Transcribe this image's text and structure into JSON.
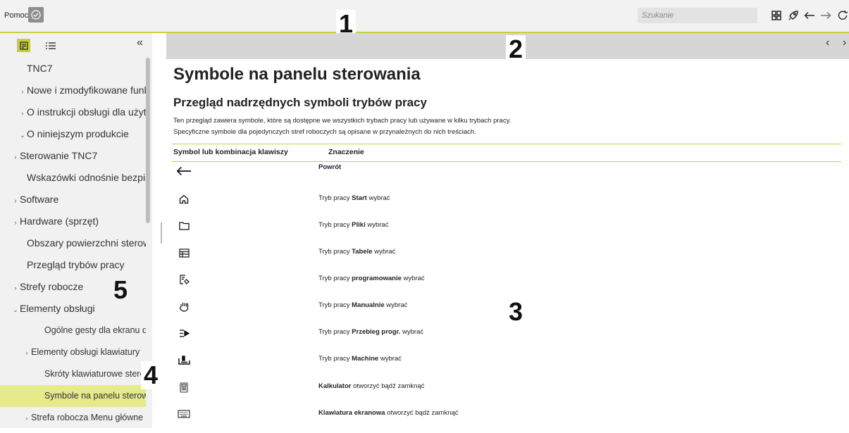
{
  "app": {
    "title": "Pomoc"
  },
  "search": {
    "placeholder": "Szukanie"
  },
  "markers": [
    "1",
    "2",
    "3",
    "4",
    "5"
  ],
  "sidebar": {
    "items": [
      {
        "label": "TNC7",
        "arrow": "",
        "level": 0
      },
      {
        "label": "Nowe i zmodyfikowane funkcje",
        "arrow": "›",
        "level": 0
      },
      {
        "label": "O instrukcji obsługi dla użytkownika",
        "arrow": "›",
        "level": 0
      },
      {
        "label": "O niniejszym produkcie",
        "arrow": "⌄",
        "level": 0
      },
      {
        "label": "Sterowanie TNC7",
        "arrow": "›",
        "level": 1
      },
      {
        "label": "Wskazówki odnośnie bezpieczeństwa",
        "arrow": "",
        "level": 1
      },
      {
        "label": "Software",
        "arrow": "›",
        "level": 1
      },
      {
        "label": "Hardware (sprzęt)",
        "arrow": "›",
        "level": 1
      },
      {
        "label": "Obszary powierzchni sterowania",
        "arrow": "",
        "level": 1
      },
      {
        "label": "Przegląd trybów pracy",
        "arrow": "",
        "level": 1
      },
      {
        "label": "Strefy robocze",
        "arrow": "›",
        "level": 1
      },
      {
        "label": "Elementy obsługi",
        "arrow": "⌄",
        "level": 1
      },
      {
        "label": "Ogólne gesty dla ekranu dotykowego",
        "arrow": "",
        "level": 2
      },
      {
        "label": "Elementy obsługi klawiatury",
        "arrow": "›",
        "level": 2
      },
      {
        "label": "Skróty klawiaturowe sterowania",
        "arrow": "",
        "level": 2
      },
      {
        "label": "Symbole na panelu sterowania",
        "arrow": "",
        "level": 2,
        "active": true
      },
      {
        "label": "Strefa robocza Menu główne",
        "arrow": "›",
        "level": 2
      }
    ]
  },
  "content": {
    "title": "Symbole na panelu sterowania",
    "section_title": "Przegląd nadrzędnych symboli trybów pracy",
    "intro_line1": "Ten przegląd zawiera symbole, które są dostępne we wszystkich trybach pracy lub używane w kilku trybach pracy.",
    "intro_line2": "Specyficzne symbole dla pojedynczych stref roboczych są opisane w przynależnych do nich treściach.",
    "table": {
      "col1": "Symbol lub kombinacja klawiszy",
      "col2": "Znaczenie",
      "rows": [
        {
          "icon": "back-arrow-icon",
          "pre": "",
          "bold": "Powrót",
          "post": ""
        },
        {
          "icon": "home-icon",
          "pre": "Tryb pracy ",
          "bold": "Start",
          "post": " wybrać"
        },
        {
          "icon": "folder-icon",
          "pre": "Tryb pracy ",
          "bold": "Pliki",
          "post": " wybrać"
        },
        {
          "icon": "table-icon",
          "pre": "Tryb pracy ",
          "bold": "Tabele",
          "post": " wybrać"
        },
        {
          "icon": "program-edit-icon",
          "pre": "Tryb pracy ",
          "bold": "programowanie",
          "post": " wybrać"
        },
        {
          "icon": "hand-icon",
          "pre": "Tryb pracy ",
          "bold": "Manualnie",
          "post": " wybrać"
        },
        {
          "icon": "program-run-icon",
          "pre": "Tryb pracy ",
          "bold": "Przebieg progr.",
          "post": " wybrać"
        },
        {
          "icon": "machine-icon",
          "pre": "Tryb pracy ",
          "bold": "Machine",
          "post": " wybrać"
        },
        {
          "icon": "calculator-icon",
          "pre": "",
          "bold": "Kalkulator",
          "post": " otworzyć bądź zamknąć"
        },
        {
          "icon": "keyboard-icon",
          "pre": "",
          "bold": "Klawiatura ekranowa",
          "post": " otworzyć bądź zamknąć"
        }
      ]
    }
  },
  "colors": {
    "accent": "#c9cf3b",
    "active_item": "#e5ea8a",
    "sidebar_bg": "#f1f1f1",
    "header_bg": "#d6d6d6"
  }
}
